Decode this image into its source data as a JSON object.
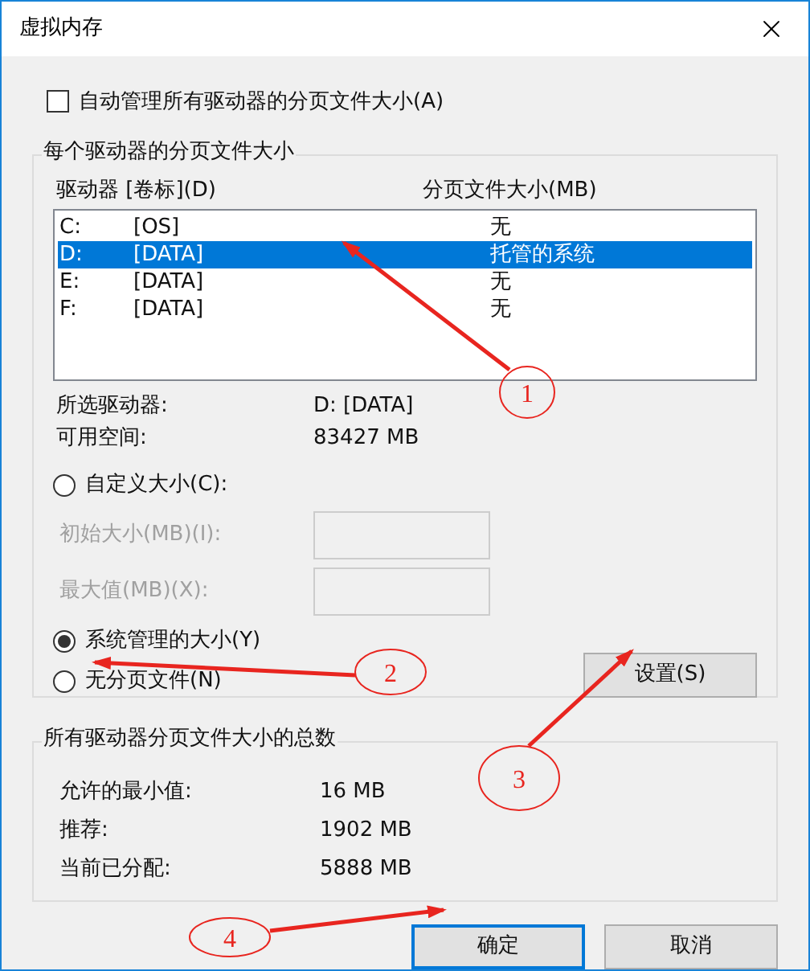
{
  "window": {
    "title": "虚拟内存"
  },
  "auto_manage": {
    "label": "自动管理所有驱动器的分页文件大小(A)",
    "checked": false
  },
  "per_drive": {
    "title": "每个驱动器的分页文件大小",
    "columns": [
      "驱动器 [卷标](D)",
      "分页文件大小(MB)"
    ],
    "drives": [
      {
        "drive": "C:",
        "label": "[OS]",
        "size": "无",
        "selected": false
      },
      {
        "drive": "D:",
        "label": "[DATA]",
        "size": "托管的系统",
        "selected": true
      },
      {
        "drive": "E:",
        "label": "[DATA]",
        "size": "无",
        "selected": false
      },
      {
        "drive": "F:",
        "label": "[DATA]",
        "size": "无",
        "selected": false
      }
    ],
    "info": [
      {
        "label": "所选驱动器:",
        "value": "D:  [DATA]"
      },
      {
        "label": "可用空间:",
        "value": "83427 MB"
      }
    ],
    "options": [
      {
        "label": "自定义大小(C):",
        "selected": false
      },
      {
        "label": "系统管理的大小(Y)",
        "selected": true
      },
      {
        "label": "无分页文件(N)",
        "selected": false
      }
    ],
    "custom_fields": [
      {
        "label": "初始大小(MB)(I):",
        "disabled": true
      },
      {
        "label": "最大值(MB)(X):",
        "disabled": true
      }
    ],
    "set_button": "设置(S)"
  },
  "totals": {
    "title": "所有驱动器分页文件大小的总数",
    "rows": [
      {
        "label": "允许的最小值:",
        "value": "16 MB"
      },
      {
        "label": "推荐:",
        "value": "1902 MB"
      },
      {
        "label": "当前已分配:",
        "value": "5888 MB"
      }
    ]
  },
  "buttons": [
    {
      "label": "确定",
      "default": true
    },
    {
      "label": "取消",
      "default": false
    }
  ],
  "annotations": [
    {
      "number": "1"
    },
    {
      "number": "2"
    },
    {
      "number": "3"
    },
    {
      "number": "4"
    }
  ]
}
